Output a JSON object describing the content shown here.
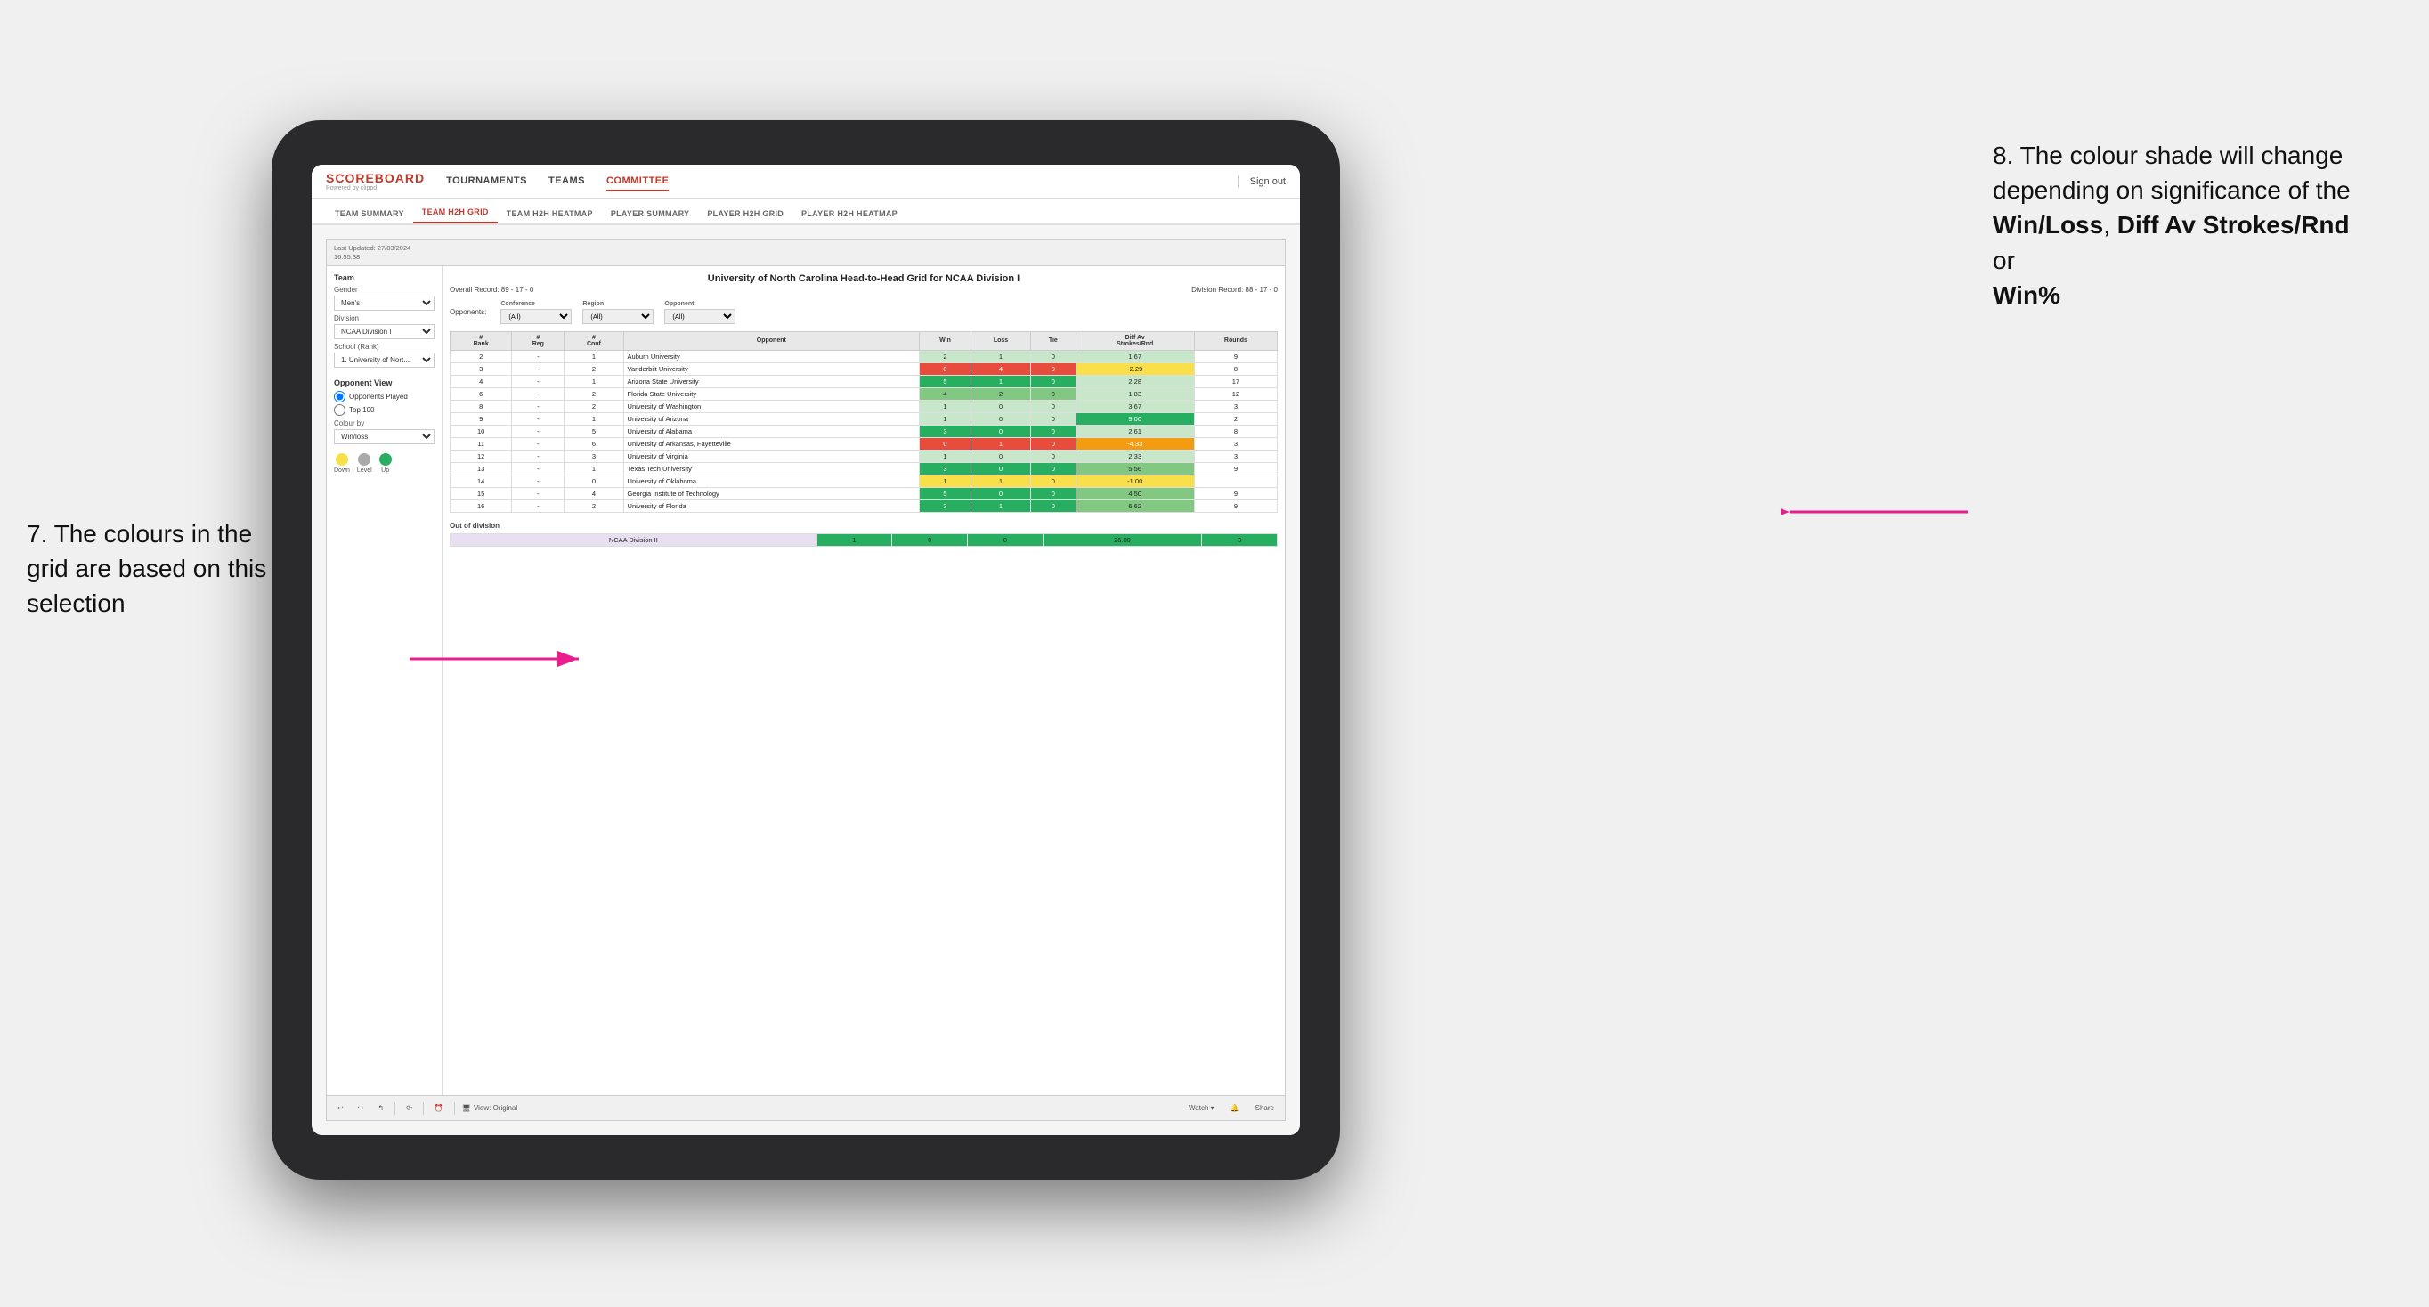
{
  "annotations": {
    "left_title": "7. The colours in the grid are based on this selection",
    "right_title": "8. The colour shade will change depending on significance of the",
    "right_bold1": "Win/Loss",
    "right_sep1": ", ",
    "right_bold2": "Diff Av Strokes/Rnd",
    "right_sep2": " or",
    "right_bold3": "Win%"
  },
  "nav": {
    "logo": "SCOREBOARD",
    "logo_sub": "Powered by clippd",
    "links": [
      "TOURNAMENTS",
      "TEAMS",
      "COMMITTEE"
    ],
    "sign_out": "Sign out"
  },
  "sub_nav": {
    "links": [
      "TEAM SUMMARY",
      "TEAM H2H GRID",
      "TEAM H2H HEATMAP",
      "PLAYER SUMMARY",
      "PLAYER H2H GRID",
      "PLAYER H2H HEATMAP"
    ]
  },
  "tableau": {
    "last_updated_label": "Last Updated: 27/03/2024",
    "last_updated_time": "16:55:38",
    "title": "University of North Carolina Head-to-Head Grid for NCAA Division I",
    "overall_record": "Overall Record: 89 - 17 - 0",
    "division_record": "Division Record: 88 - 17 - 0",
    "filters": {
      "opponents_label": "Opponents:",
      "conference_label": "Conference",
      "conference_value": "(All)",
      "region_label": "Region",
      "region_value": "(All)",
      "opponent_label": "Opponent",
      "opponent_value": "(All)"
    },
    "sidebar": {
      "team_label": "Team",
      "gender_label": "Gender",
      "gender_value": "Men's",
      "division_label": "Division",
      "division_value": "NCAA Division I",
      "school_label": "School (Rank)",
      "school_value": "1. University of Nort...",
      "opponent_view_label": "Opponent View",
      "opponents_played": "Opponents Played",
      "top_100": "Top 100",
      "colour_by_label": "Colour by",
      "colour_by_value": "Win/loss",
      "legend_down": "Down",
      "legend_level": "Level",
      "legend_up": "Up"
    },
    "table": {
      "headers": [
        "#\nRank",
        "#\nReg",
        "#\nConf",
        "Opponent",
        "Win",
        "Loss",
        "Tie",
        "Diff Av\nStrokes/Rnd",
        "Rounds"
      ],
      "rows": [
        {
          "rank": "2",
          "reg": "-",
          "conf": "1",
          "opponent": "Auburn University",
          "win": "2",
          "loss": "1",
          "tie": "0",
          "diff": "1.67",
          "rounds": "9",
          "win_color": "green_light",
          "diff_color": "green_light"
        },
        {
          "rank": "3",
          "reg": "-",
          "conf": "2",
          "opponent": "Vanderbilt University",
          "win": "0",
          "loss": "4",
          "tie": "0",
          "diff": "-2.29",
          "rounds": "8",
          "win_color": "red",
          "diff_color": "yellow"
        },
        {
          "rank": "4",
          "reg": "-",
          "conf": "1",
          "opponent": "Arizona State University",
          "win": "5",
          "loss": "1",
          "tie": "0",
          "diff": "2.28",
          "rounds": "17",
          "win_color": "green_dark",
          "diff_color": "green_light"
        },
        {
          "rank": "6",
          "reg": "-",
          "conf": "2",
          "opponent": "Florida State University",
          "win": "4",
          "loss": "2",
          "tie": "0",
          "diff": "1.83",
          "rounds": "12",
          "win_color": "green_med",
          "diff_color": "green_light"
        },
        {
          "rank": "8",
          "reg": "-",
          "conf": "2",
          "opponent": "University of Washington",
          "win": "1",
          "loss": "0",
          "tie": "0",
          "diff": "3.67",
          "rounds": "3",
          "win_color": "green_light",
          "diff_color": "green_light"
        },
        {
          "rank": "9",
          "reg": "-",
          "conf": "1",
          "opponent": "University of Arizona",
          "win": "1",
          "loss": "0",
          "tie": "0",
          "diff": "9.00",
          "rounds": "2",
          "win_color": "green_light",
          "diff_color": "green_dark"
        },
        {
          "rank": "10",
          "reg": "-",
          "conf": "5",
          "opponent": "University of Alabama",
          "win": "3",
          "loss": "0",
          "tie": "0",
          "diff": "2.61",
          "rounds": "8",
          "win_color": "green_dark",
          "diff_color": "green_light"
        },
        {
          "rank": "11",
          "reg": "-",
          "conf": "6",
          "opponent": "University of Arkansas, Fayetteville",
          "win": "0",
          "loss": "1",
          "tie": "0",
          "diff": "-4.33",
          "rounds": "3",
          "win_color": "red",
          "diff_color": "orange"
        },
        {
          "rank": "12",
          "reg": "-",
          "conf": "3",
          "opponent": "University of Virginia",
          "win": "1",
          "loss": "0",
          "tie": "0",
          "diff": "2.33",
          "rounds": "3",
          "win_color": "green_light",
          "diff_color": "green_light"
        },
        {
          "rank": "13",
          "reg": "-",
          "conf": "1",
          "opponent": "Texas Tech University",
          "win": "3",
          "loss": "0",
          "tie": "0",
          "diff": "5.56",
          "rounds": "9",
          "win_color": "green_dark",
          "diff_color": "green_med"
        },
        {
          "rank": "14",
          "reg": "-",
          "conf": "0",
          "opponent": "University of Oklahoma",
          "win": "1",
          "loss": "1",
          "tie": "0",
          "diff": "-1.00",
          "rounds": "",
          "win_color": "yellow",
          "diff_color": "yellow"
        },
        {
          "rank": "15",
          "reg": "-",
          "conf": "4",
          "opponent": "Georgia Institute of Technology",
          "win": "5",
          "loss": "0",
          "tie": "0",
          "diff": "4.50",
          "rounds": "9",
          "win_color": "green_dark",
          "diff_color": "green_med"
        },
        {
          "rank": "16",
          "reg": "-",
          "conf": "2",
          "opponent": "University of Florida",
          "win": "3",
          "loss": "1",
          "tie": "0",
          "diff": "6.62",
          "rounds": "9",
          "win_color": "green_dark",
          "diff_color": "green_med"
        }
      ],
      "out_of_division_label": "Out of division",
      "out_of_division_row": {
        "division": "NCAA Division II",
        "win": "1",
        "loss": "0",
        "tie": "0",
        "diff": "26.00",
        "rounds": "3"
      }
    },
    "bottom_toolbar": {
      "view_original": "View: Original",
      "watch": "Watch ▾",
      "share": "Share"
    }
  }
}
